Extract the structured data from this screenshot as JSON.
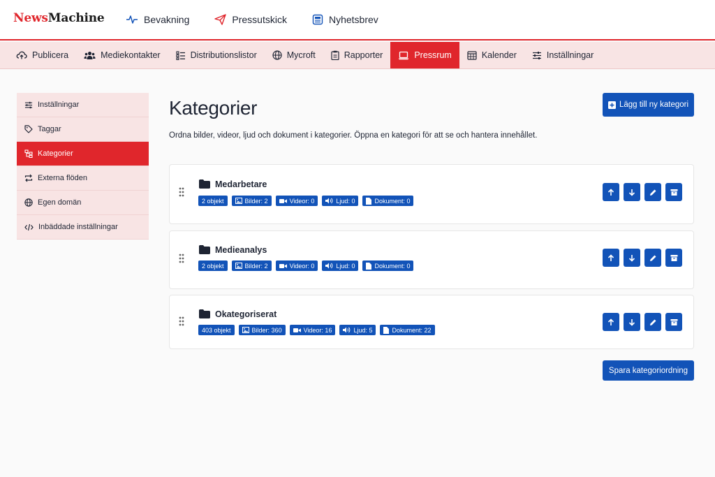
{
  "brand": {
    "part1": "News",
    "part2": "Machine"
  },
  "topnav": [
    {
      "label": "Bevakning",
      "icon": "pulse-icon"
    },
    {
      "label": "Pressutskick",
      "icon": "paper-plane-icon"
    },
    {
      "label": "Nyhetsbrev",
      "icon": "newsletter-icon"
    }
  ],
  "subnav": [
    {
      "label": "Publicera",
      "icon": "cloud-upload-icon"
    },
    {
      "label": "Mediekontakter",
      "icon": "users-icon"
    },
    {
      "label": "Distributionslistor",
      "icon": "list-icon"
    },
    {
      "label": "Mycroft",
      "icon": "globe-icon"
    },
    {
      "label": "Rapporter",
      "icon": "clipboard-icon"
    },
    {
      "label": "Pressrum",
      "icon": "laptop-icon",
      "active": true
    },
    {
      "label": "Kalender",
      "icon": "calendar-icon"
    },
    {
      "label": "Inställningar",
      "icon": "sliders-icon"
    }
  ],
  "sidebar": [
    {
      "label": "Inställningar",
      "icon": "sliders-icon"
    },
    {
      "label": "Taggar",
      "icon": "tag-icon"
    },
    {
      "label": "Kategorier",
      "icon": "category-icon",
      "active": true
    },
    {
      "label": "Externa flöden",
      "icon": "sync-icon"
    },
    {
      "label": "Egen domän",
      "icon": "globe-icon"
    },
    {
      "label": "Inbäddade inställningar",
      "icon": "code-icon"
    }
  ],
  "main": {
    "title": "Kategorier",
    "description": "Ordna bilder, videor, ljud och dokument i kategorier. Öppna en kategori för att se och hantera innehållet.",
    "add_label": "Lägg till ny kategori",
    "save_label": "Spara kategoriordning"
  },
  "categories": [
    {
      "name": "Medarbetare",
      "objects": "2 objekt",
      "images": "Bilder: 2",
      "videos": "Videor: 0",
      "audio": "Ljud: 0",
      "documents": "Dokument: 0"
    },
    {
      "name": "Medieanalys",
      "objects": "2 objekt",
      "images": "Bilder: 2",
      "videos": "Videor: 0",
      "audio": "Ljud: 0",
      "documents": "Dokument: 0"
    },
    {
      "name": "Okategoriserat",
      "objects": "403 objekt",
      "images": "Bilder: 360",
      "videos": "Videor: 16",
      "audio": "Ljud: 5",
      "documents": "Dokument: 22"
    }
  ],
  "colors": {
    "brand_red": "#e0262c",
    "primary_blue": "#1253b8",
    "nav_bg": "#f8e4e4"
  }
}
